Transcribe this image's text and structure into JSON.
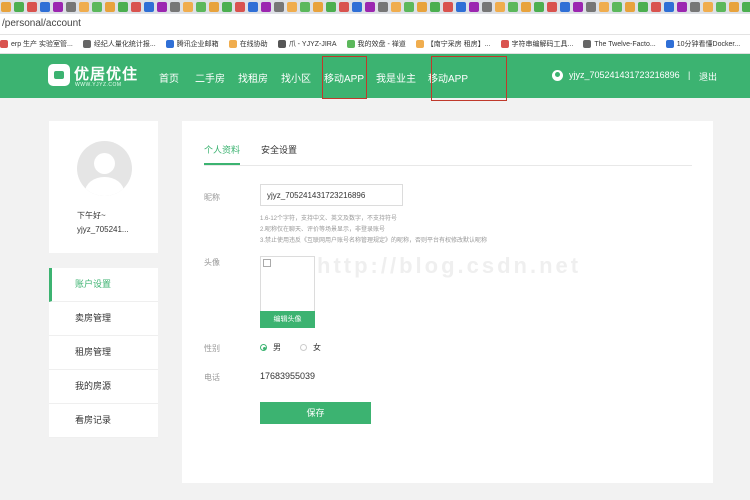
{
  "browser": {
    "url": "/personal/account",
    "bookmarks": [
      {
        "label": "erp 生产 实验室管...",
        "color": "#d9534f"
      },
      {
        "label": "经纪人量化统计报...",
        "color": "#666666"
      },
      {
        "label": "腾讯企业邮箱",
        "color": "#2f6fd6"
      },
      {
        "label": "在线协助",
        "color": "#f0ad4e"
      },
      {
        "label": "爪 - YJYZ-JIRA",
        "color": "#555555"
      },
      {
        "label": "我的效盘 - 禅道",
        "color": "#5cb85c"
      },
      {
        "label": "【南宁采房 租房】...",
        "color": "#f0ad4e"
      },
      {
        "label": "字符串编解码工具...",
        "color": "#d9534f"
      },
      {
        "label": "The Twelve-Facto...",
        "color": "#666666"
      },
      {
        "label": "10分钟看懂Docker...",
        "color": "#2f6fd6"
      }
    ]
  },
  "header": {
    "logo_text": "优居优住",
    "logo_sub": "WWW.YJYZ.COM",
    "nav": [
      "首页",
      "二手房",
      "找租房",
      "找小区",
      "移动APP",
      "我是业主",
      "移动APP"
    ],
    "username": "yjyz_705241431723216896",
    "separator": "|",
    "logout": "退出",
    "brand_color": "#3cb371"
  },
  "profile": {
    "greeting": "下午好~",
    "short_name": "yjyz_705241..."
  },
  "side_menu": [
    "账户设置",
    "卖房管理",
    "租房管理",
    "我的房源",
    "看房记录"
  ],
  "main": {
    "tabs": [
      "个人资料",
      "安全设置"
    ],
    "nickname_label": "昵称",
    "nickname_value": "yjyz_705241431723216896",
    "hints": [
      "1.6-12个字符，支持中文、英文及数字，不支持符号",
      "2.昵称仅在聊天、评价等场景显示，非登录账号",
      "3.禁止使用违反《互联网用户账号名称管理规定》的昵称，否则平台有权修改默认昵称"
    ],
    "avatar_label": "头像",
    "edit_avatar": "编辑头像",
    "watermark": "http://blog.csdn.net",
    "gender_label": "性别",
    "gender_male": "男",
    "gender_female": "女",
    "phone_label": "电话",
    "phone_value": "17683955039",
    "save": "保存"
  }
}
